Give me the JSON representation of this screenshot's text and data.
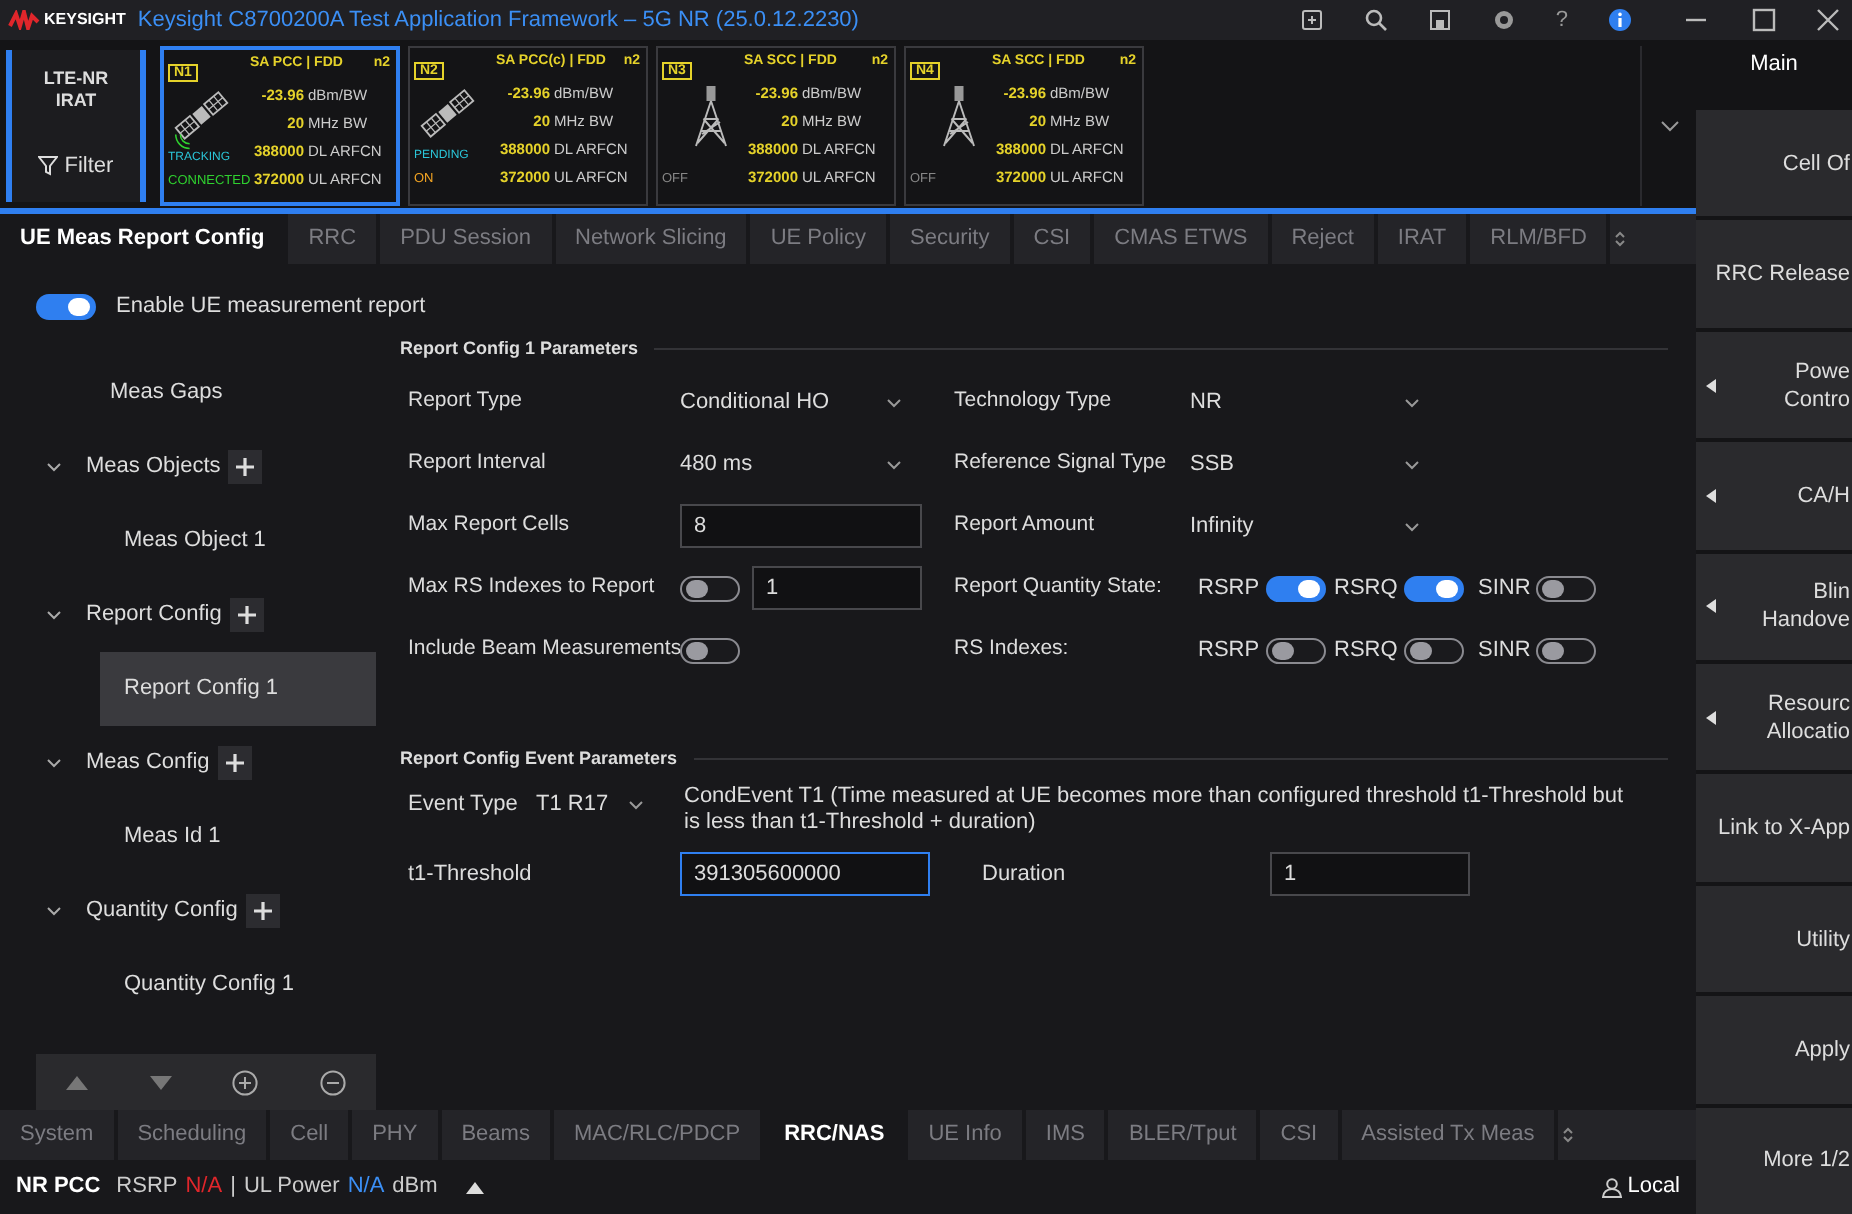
{
  "window": {
    "brand": "KEYSIGHT",
    "title": "Keysight C8700200A Test Application Framework – 5G NR (25.0.12.2230)",
    "help": "?"
  },
  "cell_bar": {
    "mode_lines": [
      "LTE-NR",
      "IRAT"
    ],
    "filter": "Filter",
    "cells": [
      {
        "badge": "N1",
        "header": "SA PCC | FDD",
        "band": "n2",
        "kind": "satellite",
        "waves": true,
        "selected": true,
        "tracking": "TRACKING",
        "state": {
          "text": "CONNECTED",
          "color": "#2fd12f"
        },
        "metrics": [
          {
            "value": "-23.96",
            "unit": "dBm/BW"
          },
          {
            "value": "20",
            "unit": "MHz BW"
          },
          {
            "value": "388000",
            "unit": "DL ARFCN"
          },
          {
            "value": "372000",
            "unit": "UL ARFCN"
          }
        ]
      },
      {
        "badge": "N2",
        "header": "SA PCC(c) | FDD",
        "band": "n2",
        "kind": "satellite",
        "waves": false,
        "selected": false,
        "tracking": "PENDING",
        "state": {
          "text": "ON",
          "color": "#f5a623"
        },
        "metrics": [
          {
            "value": "-23.96",
            "unit": "dBm/BW"
          },
          {
            "value": "20",
            "unit": "MHz BW"
          },
          {
            "value": "388000",
            "unit": "DL ARFCN"
          },
          {
            "value": "372000",
            "unit": "UL ARFCN"
          }
        ]
      },
      {
        "badge": "N3",
        "header": "SA SCC | FDD",
        "band": "n2",
        "kind": "tower",
        "selected": false,
        "state": {
          "text": "OFF",
          "color": "#888888"
        },
        "metrics": [
          {
            "value": "-23.96",
            "unit": "dBm/BW"
          },
          {
            "value": "20",
            "unit": "MHz BW"
          },
          {
            "value": "388000",
            "unit": "DL ARFCN"
          },
          {
            "value": "372000",
            "unit": "UL ARFCN"
          }
        ]
      },
      {
        "badge": "N4",
        "header": "SA SCC | FDD",
        "band": "n2",
        "kind": "tower",
        "selected": false,
        "state": {
          "text": "OFF",
          "color": "#888888"
        },
        "metrics": [
          {
            "value": "-23.96",
            "unit": "dBm/BW"
          },
          {
            "value": "20",
            "unit": "MHz BW"
          },
          {
            "value": "388000",
            "unit": "DL ARFCN"
          },
          {
            "value": "372000",
            "unit": "UL ARFCN"
          }
        ]
      }
    ]
  },
  "tabs": [
    {
      "label": "UE Meas Report Config",
      "selected": true
    },
    {
      "label": "RRC",
      "selected": false
    },
    {
      "label": "PDU Session",
      "selected": false
    },
    {
      "label": "Network Slicing",
      "selected": false
    },
    {
      "label": "UE Policy",
      "selected": false
    },
    {
      "label": "Security",
      "selected": false
    },
    {
      "label": "CSI",
      "selected": false
    },
    {
      "label": "CMAS ETWS",
      "selected": false
    },
    {
      "label": "Reject",
      "selected": false
    },
    {
      "label": "IRAT",
      "selected": false
    },
    {
      "label": "RLM/BFD",
      "selected": false
    }
  ],
  "enable_toggle": {
    "label": "Enable UE measurement report",
    "on": true
  },
  "tree": [
    {
      "label": "Meas Gaps"
    },
    {
      "label": "Meas Objects",
      "addable": true,
      "expanded": true,
      "children": [
        {
          "label": "Meas Object 1",
          "selected": false
        }
      ]
    },
    {
      "label": "Report Config",
      "addable": true,
      "expanded": true,
      "children": [
        {
          "label": "Report Config 1",
          "selected": true
        }
      ]
    },
    {
      "label": "Meas Config",
      "addable": true,
      "expanded": true,
      "children": [
        {
          "label": "Meas Id 1",
          "selected": false
        }
      ]
    },
    {
      "label": "Quantity Config",
      "addable": true,
      "expanded": true,
      "children": [
        {
          "label": "Quantity Config 1",
          "selected": false
        }
      ]
    }
  ],
  "parameters": {
    "title": "Report Config 1 Parameters",
    "fields": [
      {
        "label": "Report Type",
        "kind": "dropdown",
        "value": "Conditional HO"
      },
      {
        "label": "Technology Type",
        "kind": "dropdown",
        "value": "NR"
      },
      {
        "label": "Report Interval",
        "kind": "dropdown",
        "value": "480 ms"
      },
      {
        "label": "Reference Signal Type",
        "kind": "dropdown",
        "value": "SSB"
      },
      {
        "label": "Max Report Cells",
        "kind": "input",
        "value": "8"
      },
      {
        "label": "Report Amount",
        "kind": "dropdown",
        "value": "Infinity"
      },
      {
        "label": "Max RS Indexes to Report",
        "kind": "toggle-input",
        "on": false,
        "value": "1"
      },
      {
        "label": "Report Quantity State:",
        "kind": "toggles",
        "toggles": [
          {
            "label": "RSRP",
            "on": true
          },
          {
            "label": "RSRQ",
            "on": true
          },
          {
            "label": "SINR",
            "on": false
          }
        ]
      },
      {
        "label": "Include Beam Measurements",
        "kind": "toggle",
        "on": false
      },
      {
        "label": "RS Indexes:",
        "kind": "toggles",
        "toggles": [
          {
            "label": "RSRP",
            "on": false
          },
          {
            "label": "RSRQ",
            "on": false
          },
          {
            "label": "SINR",
            "on": false
          }
        ]
      }
    ]
  },
  "event": {
    "title": "Report Config Event Parameters",
    "event_type_label": "Event Type",
    "event_type": "T1 R17",
    "description": "CondEvent T1 (Time measured at UE becomes more than configured threshold t1-Threshold but is less than t1-Threshold + duration)",
    "fields": [
      {
        "label": "t1-Threshold",
        "value": "391305600000",
        "focused": true
      },
      {
        "label": "Duration",
        "value": "1",
        "focused": false
      }
    ]
  },
  "bottom_tabs": [
    {
      "label": "System",
      "selected": false
    },
    {
      "label": "Scheduling",
      "selected": false
    },
    {
      "label": "Cell",
      "selected": false
    },
    {
      "label": "PHY",
      "selected": false
    },
    {
      "label": "Beams",
      "selected": false
    },
    {
      "label": "MAC/RLC/PDCP",
      "selected": false
    },
    {
      "label": "RRC/NAS",
      "selected": true
    },
    {
      "label": "UE Info",
      "selected": false
    },
    {
      "label": "IMS",
      "selected": false
    },
    {
      "label": "BLER/Tput",
      "selected": false
    },
    {
      "label": "CSI",
      "selected": false
    },
    {
      "label": "Assisted Tx Meas",
      "selected": false
    }
  ],
  "status_bar": {
    "items": [
      {
        "text": "NR PCC",
        "kind": "label"
      },
      {
        "text": "RSRP",
        "kind": "plain"
      },
      {
        "text": "N/A",
        "kind": "bad"
      },
      {
        "text": "|",
        "kind": "plain"
      },
      {
        "text": "UL Power",
        "kind": "plain"
      },
      {
        "text": "N/A",
        "kind": "info"
      },
      {
        "text": "dBm",
        "kind": "plain"
      }
    ],
    "user": "Local"
  },
  "soft_keys": {
    "header": "Main",
    "keys": [
      {
        "lines": [
          "Cell Of"
        ],
        "submenu": false
      },
      {
        "lines": [
          "RRC Release"
        ],
        "submenu": false
      },
      {
        "lines": [
          "Powe",
          "Contro"
        ],
        "submenu": true
      },
      {
        "lines": [
          "CA/H"
        ],
        "submenu": true
      },
      {
        "lines": [
          "Blin",
          "Handove"
        ],
        "submenu": true
      },
      {
        "lines": [
          "Resourc",
          "Allocatio"
        ],
        "submenu": true
      },
      {
        "lines": [
          "Link to X-App"
        ],
        "submenu": false
      },
      {
        "lines": [
          "Utility"
        ],
        "submenu": false
      },
      {
        "lines": [
          "Apply"
        ],
        "submenu": false
      },
      {
        "lines": [
          "More 1/2"
        ],
        "submenu": false
      }
    ]
  }
}
